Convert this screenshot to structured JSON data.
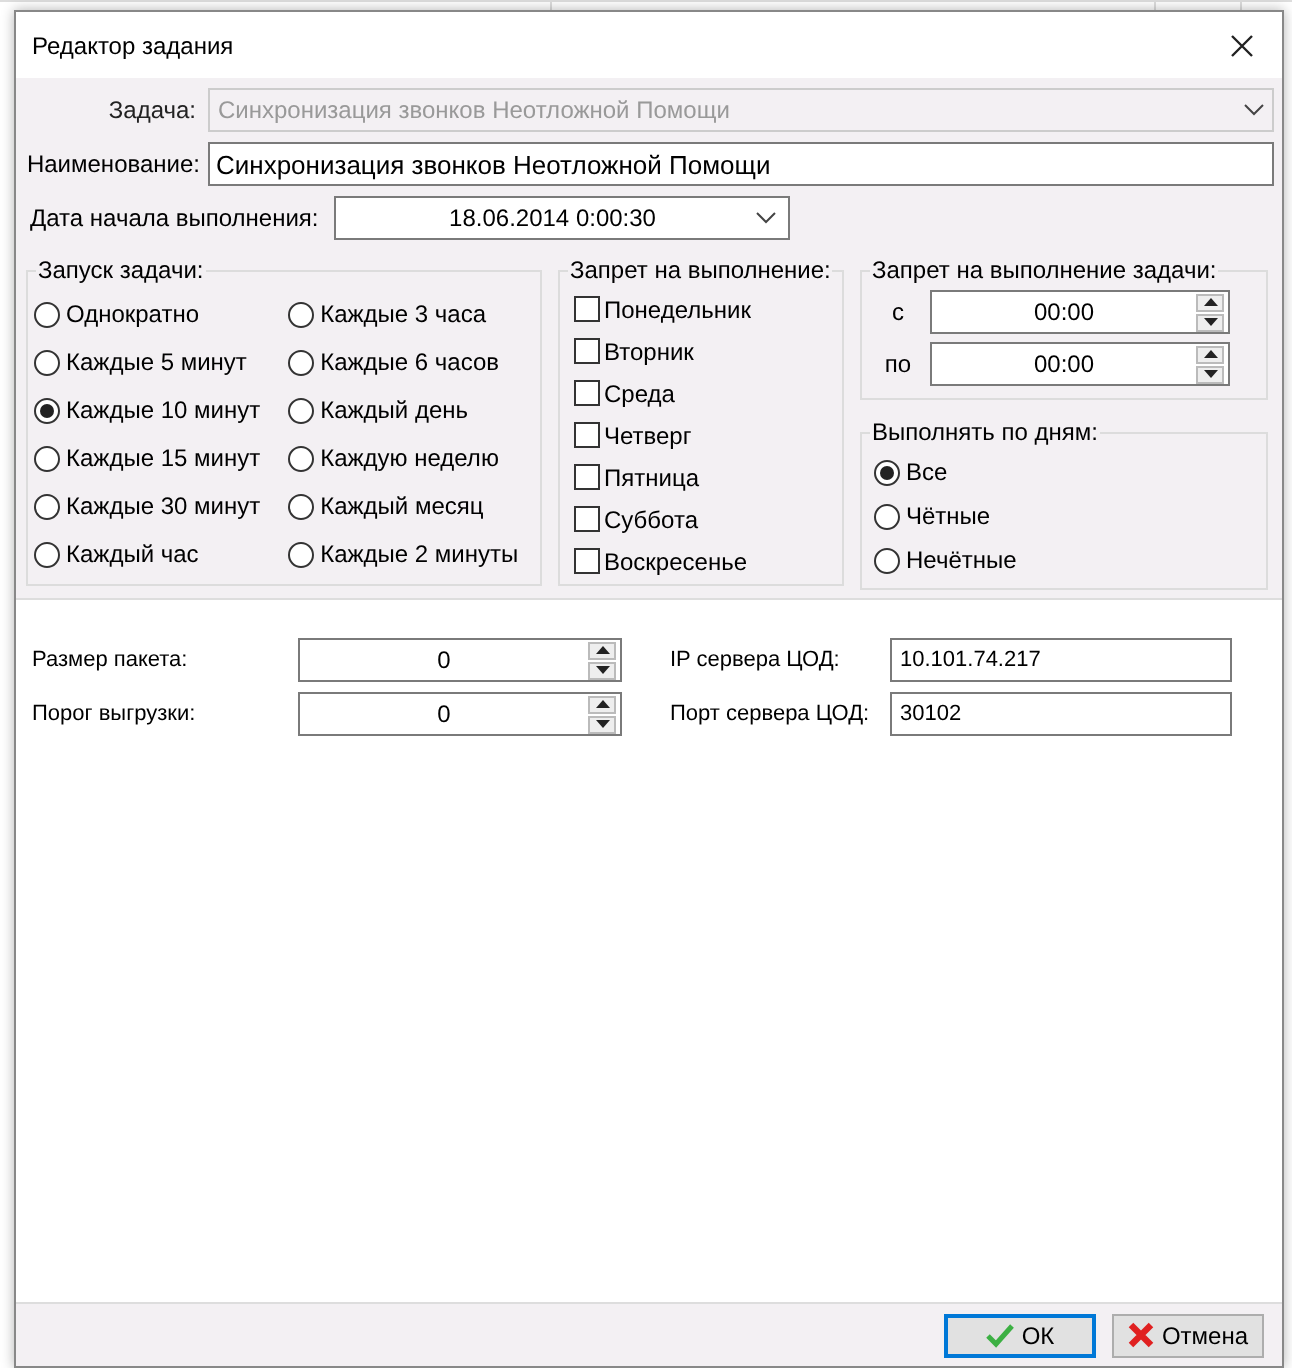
{
  "window": {
    "title": "Редактор задания"
  },
  "task": {
    "label": "Задача:",
    "value": "Синхронизация звонков Неотложной Помощи",
    "disabled": true
  },
  "name": {
    "label": "Наименование:",
    "value": "Синхронизация звонков Неотложной Помощи"
  },
  "start_date": {
    "label": "Дата начала выполнения:",
    "value": "18.06.2014 0:00:30"
  },
  "launch": {
    "title": "Запуск задачи:",
    "options": [
      {
        "label": "Однократно",
        "selected": false
      },
      {
        "label": "Каждые 5 минут",
        "selected": false
      },
      {
        "label": "Каждые 10 минут",
        "selected": true
      },
      {
        "label": "Каждые 15 минут",
        "selected": false
      },
      {
        "label": "Каждые 30 минут",
        "selected": false
      },
      {
        "label": "Каждый час",
        "selected": false
      },
      {
        "label": "Каждые 3 часа",
        "selected": false
      },
      {
        "label": "Каждые 6 часов",
        "selected": false
      },
      {
        "label": "Каждый день",
        "selected": false
      },
      {
        "label": "Каждую неделю",
        "selected": false
      },
      {
        "label": "Каждый месяц",
        "selected": false
      },
      {
        "label": "Каждые 2 минуты",
        "selected": false
      }
    ]
  },
  "forbid_days": {
    "title": "Запрет на выполнение:",
    "days": [
      {
        "label": "Понедельник",
        "checked": false
      },
      {
        "label": "Вторник",
        "checked": false
      },
      {
        "label": "Среда",
        "checked": false
      },
      {
        "label": "Четверг",
        "checked": false
      },
      {
        "label": "Пятница",
        "checked": false
      },
      {
        "label": "Суббота",
        "checked": false
      },
      {
        "label": "Воскресенье",
        "checked": false
      }
    ]
  },
  "forbid_time": {
    "title": "Запрет на выполнение задачи:",
    "fields": [
      {
        "label": "с",
        "value": "00:00"
      },
      {
        "label": "по",
        "value": "00:00"
      }
    ]
  },
  "run_days": {
    "title": "Выполнять по дням:",
    "options": [
      {
        "label": "Все",
        "selected": true
      },
      {
        "label": "Чётные",
        "selected": false
      },
      {
        "label": "Нечётные",
        "selected": false
      }
    ]
  },
  "settings": {
    "left": [
      {
        "label": "Размер пакета:",
        "value": "0"
      },
      {
        "label": "Порог выгрузки:",
        "value": "0"
      }
    ],
    "right": [
      {
        "label": "IP сервера ЦОД:",
        "value": "10.101.74.217"
      },
      {
        "label": "Порт сервера ЦОД:",
        "value": "30102"
      }
    ]
  },
  "buttons": [
    {
      "kind": "ok",
      "label": "ОК",
      "focused": true
    },
    {
      "kind": "cancel",
      "label": "Отмена",
      "focused": false
    }
  ]
}
